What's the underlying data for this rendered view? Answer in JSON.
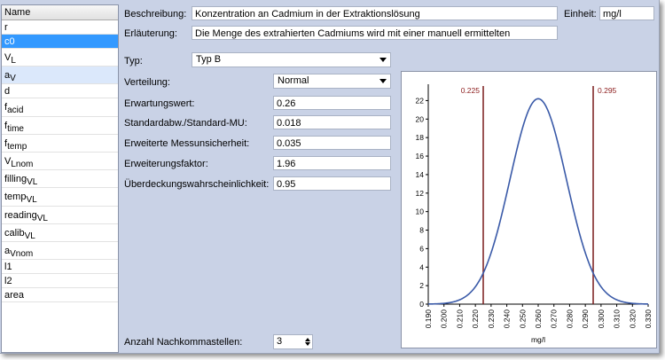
{
  "list": {
    "header": "Name",
    "items": [
      {
        "base": "r",
        "sub": "",
        "sup": ""
      },
      {
        "base": "c0",
        "sub": "",
        "sup": "",
        "state": "selected"
      },
      {
        "base": "V",
        "sub": "L",
        "sup": ""
      },
      {
        "base": "a",
        "sub": "V",
        "sup": "",
        "state": "hover"
      },
      {
        "base": "d",
        "sub": "",
        "sup": ""
      },
      {
        "base": "f",
        "sub": "acid",
        "sup": ""
      },
      {
        "base": "f",
        "sub": "time",
        "sup": ""
      },
      {
        "base": "f",
        "sub": "temp",
        "sup": ""
      },
      {
        "base": "V",
        "sub": "Lnom",
        "sup": ""
      },
      {
        "base": "filling",
        "sub": "VL",
        "sup": ""
      },
      {
        "base": "temp",
        "sub": "VL",
        "sup": ""
      },
      {
        "base": "reading",
        "sub": "VL",
        "sup": ""
      },
      {
        "base": "calib",
        "sub": "VL",
        "sup": ""
      },
      {
        "base": "a",
        "sub": "Vnom",
        "sup": ""
      },
      {
        "base": "l1",
        "sub": "",
        "sup": ""
      },
      {
        "base": "l2",
        "sub": "",
        "sup": ""
      },
      {
        "base": "area",
        "sub": "",
        "sup": ""
      }
    ]
  },
  "form": {
    "beschreibung_label": "Beschreibung:",
    "beschreibung_value": "Konzentration an Cadmium in der Extraktionslösung",
    "einheit_label": "Einheit:",
    "einheit_value": "mg/l",
    "erlaeuterung_label": "Erläuterung:",
    "erlaeuterung_value": "Die Menge des extrahierten Cadmiums wird mit einer manuell ermittelten",
    "typ_label": "Typ:",
    "typ_value": "Typ B",
    "verteilung_label": "Verteilung:",
    "verteilung_value": "Normal",
    "erwartungswert_label": "Erwartungswert:",
    "erwartungswert_value": "0.26",
    "standardabw_label": "Standardabw./Standard-MU:",
    "standardabw_value": "0.018",
    "erw_unsicherheit_label": "Erweiterte Messunsicherheit:",
    "erw_unsicherheit_value": "0.035",
    "erw_faktor_label": "Erweiterungsfaktor:",
    "erw_faktor_value": "1.96",
    "ueberdeckung_label": "Überdeckungswahrscheinlichkeit:",
    "ueberdeckung_value": "0.95",
    "nachkomma_label": "Anzahl Nachkommastellen:",
    "nachkomma_value": "3"
  },
  "chart_data": {
    "type": "line",
    "xlabel": "mg/l",
    "ylabel": "",
    "xlim": [
      0.19,
      0.33
    ],
    "ylim": [
      0,
      23
    ],
    "xticks": [
      "0.190",
      "0.200",
      "0.210",
      "0.220",
      "0.230",
      "0.240",
      "0.250",
      "0.260",
      "0.270",
      "0.280",
      "0.290",
      "0.300",
      "0.310",
      "0.320",
      "0.330"
    ],
    "yticks": [
      "0",
      "2",
      "4",
      "6",
      "8",
      "10",
      "12",
      "14",
      "16",
      "18",
      "20",
      "22"
    ],
    "grid": false,
    "distribution": {
      "name": "",
      "mean": 0.26,
      "sd": 0.018,
      "peak": 22.2
    },
    "vlines": [
      {
        "x": 0.225,
        "label": "0.225"
      },
      {
        "x": 0.295,
        "label": "0.295"
      }
    ],
    "colors": {
      "curve": "#3a5aa8",
      "vline": "#7a1b1b",
      "vlabel": "#8b1a1a"
    }
  }
}
